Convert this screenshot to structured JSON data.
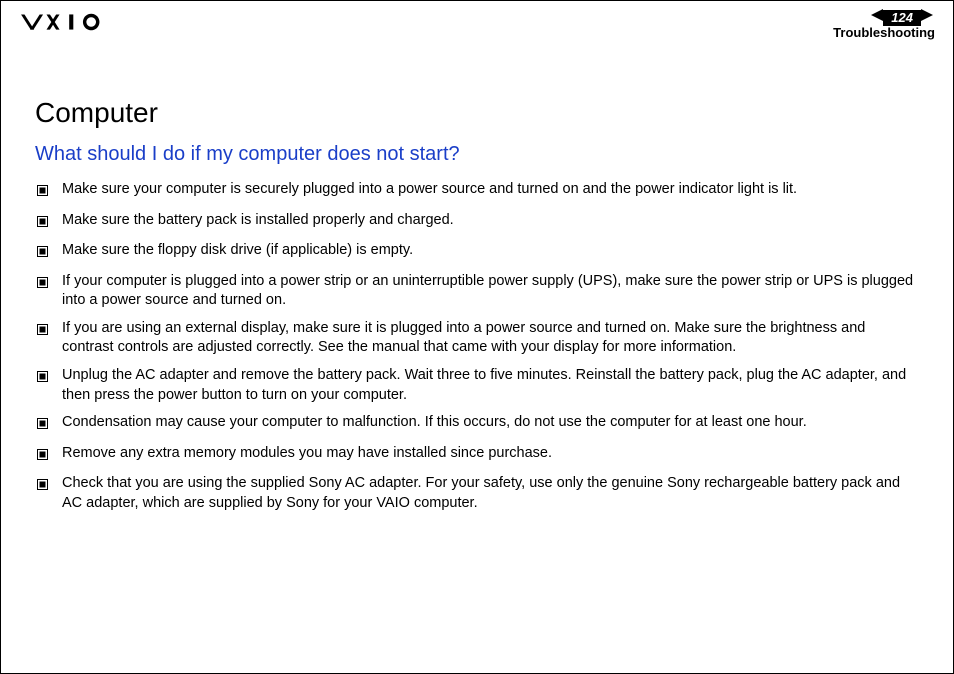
{
  "header": {
    "page_number": "124",
    "section_label": "Troubleshooting"
  },
  "content": {
    "heading1": "Computer",
    "heading2": "What should I do if my computer does not start?",
    "bullets": [
      "Make sure your computer is securely plugged into a power source and turned on and the power indicator light is lit.",
      "Make sure the battery pack is installed properly and charged.",
      "Make sure the floppy disk drive (if applicable) is empty.",
      "If your computer is plugged into a power strip or an uninterruptible power supply (UPS), make sure the power strip or UPS is plugged into a power source and turned on.",
      "If you are using an external display, make sure it is plugged into a power source and turned on. Make sure the brightness and contrast controls are adjusted correctly. See the manual that came with your display for more information.",
      "Unplug the AC adapter and remove the battery pack. Wait three to five minutes. Reinstall the battery pack, plug the AC adapter, and then press the power button to turn on your computer.",
      "Condensation may cause your computer to malfunction. If this occurs, do not use the computer for at least one hour.",
      "Remove any extra memory modules you may have installed since purchase.",
      "Check that you are using the supplied Sony AC adapter. For your safety, use only the genuine Sony rechargeable battery pack and AC adapter, which are supplied by Sony for your VAIO computer."
    ]
  }
}
